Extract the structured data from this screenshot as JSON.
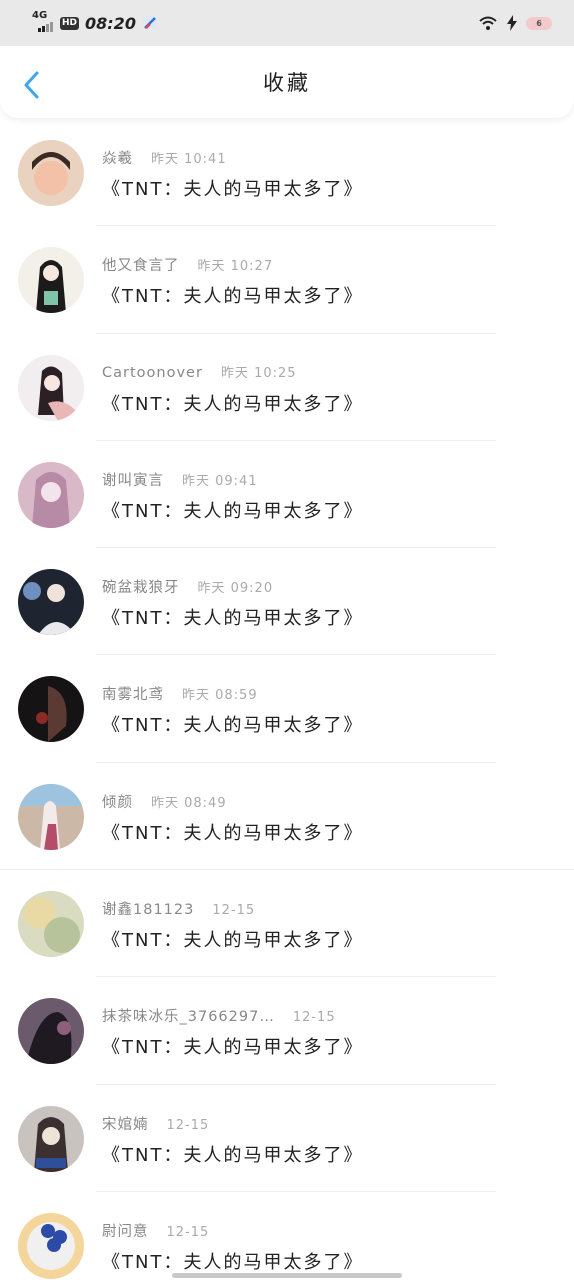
{
  "status_bar": {
    "network": "4G",
    "hd": "HD",
    "time": "08:20",
    "battery": "6"
  },
  "header": {
    "title": "收藏"
  },
  "items": [
    {
      "username": "焱羲",
      "time": "昨天 10:41",
      "content": "《TNT：夫人的马甲太多了》",
      "avatar": {
        "bg": "#e9d2bf",
        "fg": "#3b2a22",
        "accent": "#f2c1a8"
      }
    },
    {
      "username": "他又食言了",
      "time": "昨天 10:27",
      "content": "《TNT：夫人的马甲太多了》",
      "avatar": {
        "bg": "#f3f0ea",
        "fg": "#1c1a1a",
        "accent": "#7fc4a8"
      }
    },
    {
      "username": "Cartoonover",
      "time": "昨天 10:25",
      "content": "《TNT：夫人的马甲太多了》",
      "avatar": {
        "bg": "#f2eef0",
        "fg": "#2b2024",
        "accent": "#e9b7b5"
      }
    },
    {
      "username": "谢叫寅言",
      "time": "昨天 09:41",
      "content": "《TNT：夫人的马甲太多了》",
      "avatar": {
        "bg": "#d9b9c8",
        "fg": "#f3e3ec",
        "accent": "#b78aa5"
      }
    },
    {
      "username": "碗盆栽狼牙",
      "time": "昨天 09:20",
      "content": "《TNT：夫人的马甲太多了》",
      "avatar": {
        "bg": "#1e2430",
        "fg": "#e9e9ee",
        "accent": "#6f8fbf"
      }
    },
    {
      "username": "南雾北鸢",
      "time": "昨天 08:59",
      "content": "《TNT：夫人的马甲太多了》",
      "avatar": {
        "bg": "#161314",
        "fg": "#5a3a33",
        "accent": "#8a2b25"
      }
    },
    {
      "username": "倾颜",
      "time": "昨天 08:49",
      "content": "《TNT：夫人的马甲太多了》",
      "avatar": {
        "bg": "#cbb8a7",
        "fg": "#f3eaea",
        "accent": "#b54d68"
      }
    },
    {
      "username": "谢鑫181123",
      "time": "12-15",
      "content": "《TNT：夫人的马甲太多了》",
      "avatar": {
        "bg": "#d9dcc0",
        "fg": "#b7c39b",
        "accent": "#e9d9a5"
      }
    },
    {
      "username": "抹茶味冰乐_3766297…",
      "time": "12-15",
      "content": "《TNT：夫人的马甲太多了》",
      "avatar": {
        "bg": "#6a5a6c",
        "fg": "#1f1a22",
        "accent": "#8e5f7a"
      }
    },
    {
      "username": "宋婠婻",
      "time": "12-15",
      "content": "《TNT：夫人的马甲太多了》",
      "avatar": {
        "bg": "#c9c3bf",
        "fg": "#3b2f2f",
        "accent": "#2f4f9a"
      }
    },
    {
      "username": "尉问意",
      "time": "12-15",
      "content": "《TNT：夫人的马甲太多了》",
      "avatar": {
        "bg": "#f4d59b",
        "fg": "#2c4aa8",
        "accent": "#f0f0f0"
      }
    }
  ]
}
